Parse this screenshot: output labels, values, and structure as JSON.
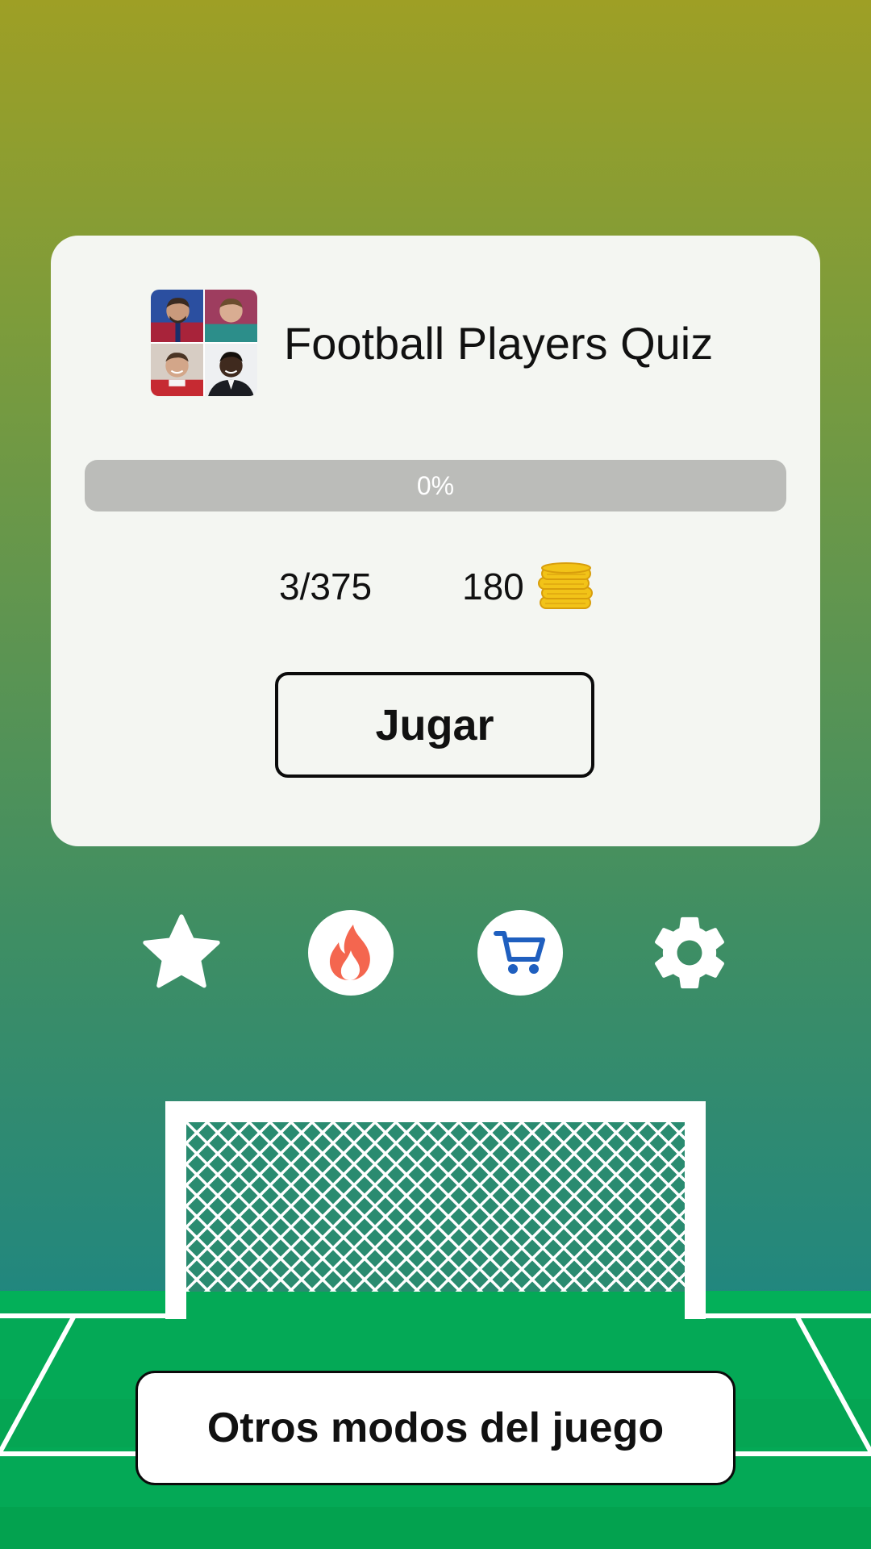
{
  "app": {
    "title": "Football Players Quiz"
  },
  "progress": {
    "label": "0%",
    "fraction": 0
  },
  "stats": {
    "levels": "3/375",
    "coins": "180"
  },
  "buttons": {
    "play": "Jugar",
    "other_modes": "Otros modos del juego"
  },
  "icons": [
    {
      "name": "star-icon"
    },
    {
      "name": "fire-icon"
    },
    {
      "name": "shopping-cart-icon"
    },
    {
      "name": "gear-icon"
    }
  ],
  "colors": {
    "fire": "#f4664f",
    "cart": "#1f5fbf",
    "coin": "#f2c318",
    "grass": "#04a956"
  }
}
